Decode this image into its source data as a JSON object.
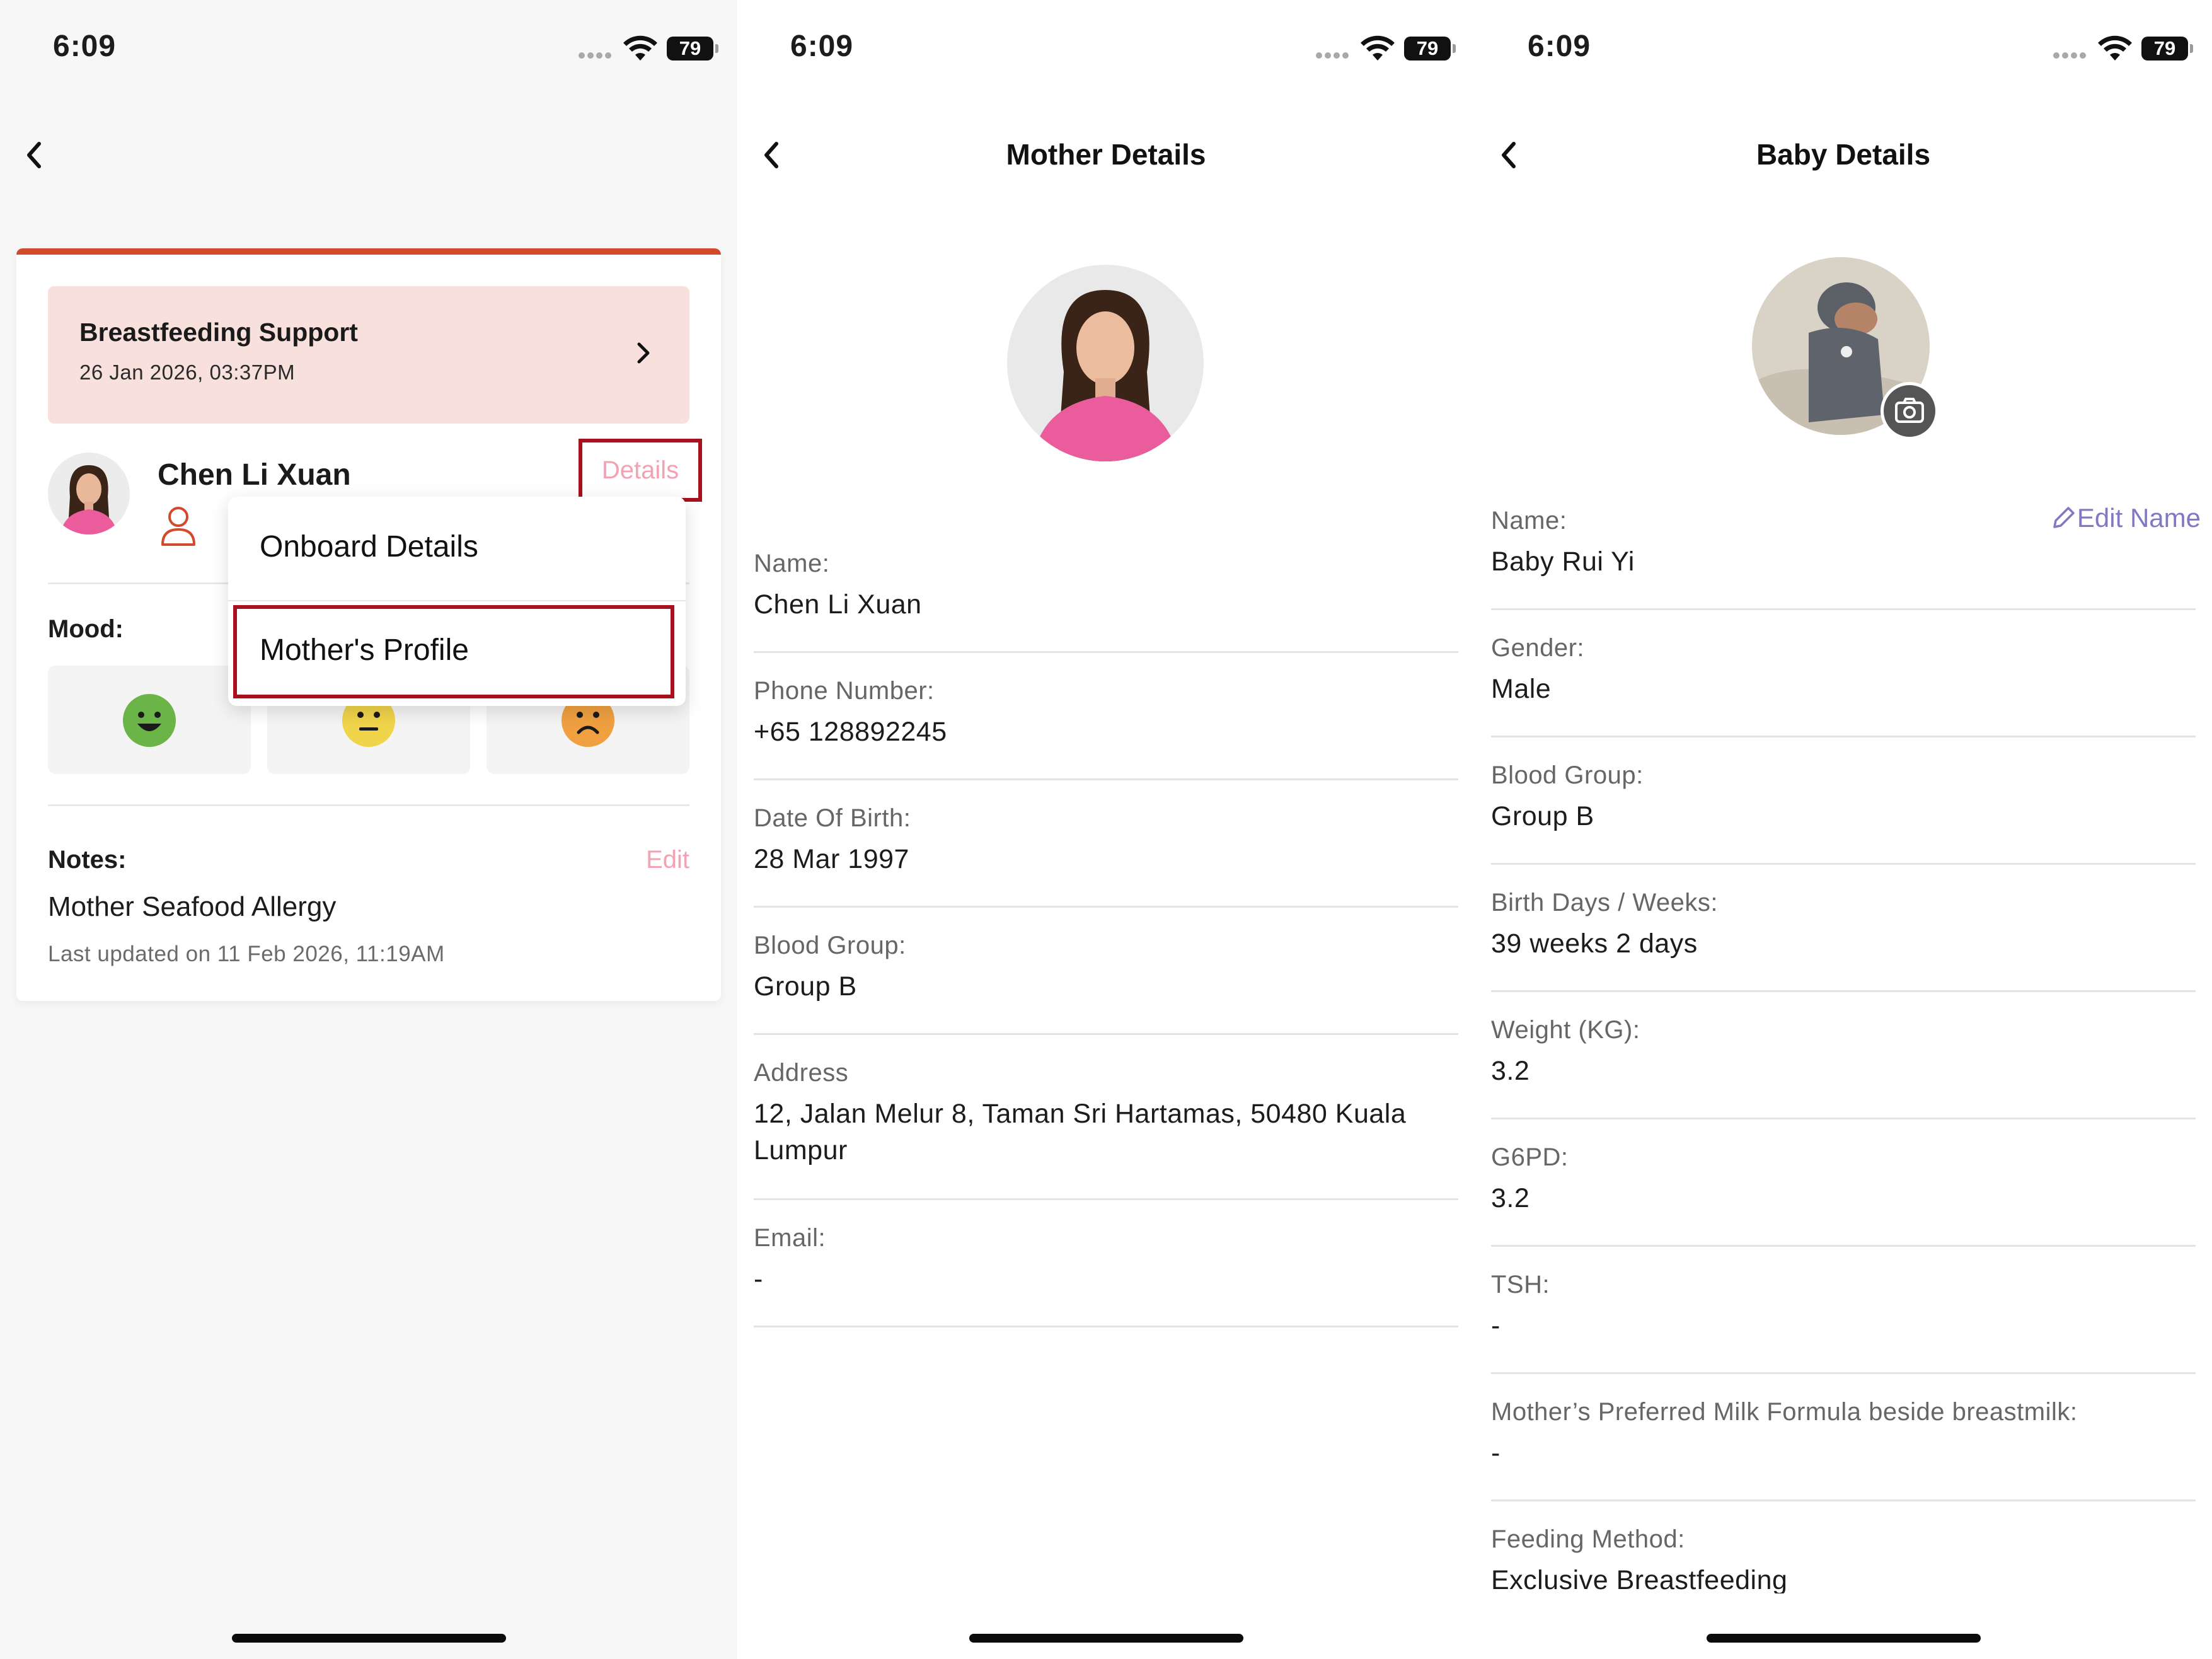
{
  "status_bar": {
    "time": "6:09",
    "battery": "79"
  },
  "screen1": {
    "session": {
      "title": "Breastfeeding Support",
      "date": "26 Jan 2026, 03:37PM"
    },
    "mother_name": "Chen Li Xuan",
    "details_link": "Details",
    "mood_label": "Mood:",
    "notes": {
      "label": "Notes:",
      "edit": "Edit",
      "text": "Mother Seafood Allergy",
      "updated": "Last updated on 11 Feb 2026, 11:19AM"
    },
    "dropdown": {
      "item1": "Onboard Details",
      "item2": "Mother's Profile"
    },
    "colors": {
      "accent": "#d24a2c",
      "highlight_box": "#a8111c",
      "session_bg": "#f8e1dc"
    }
  },
  "screen2": {
    "title": "Mother Details",
    "fields": [
      {
        "label": "Name:",
        "value": "Chen Li Xuan"
      },
      {
        "label": "Phone Number:",
        "value": "+65 128892245"
      },
      {
        "label": "Date Of Birth:",
        "value": "28 Mar 1997"
      },
      {
        "label": "Blood Group:",
        "value": "Group B"
      },
      {
        "label": "Address",
        "value_line1": "12, Jalan Melur 8, Taman Sri Hartamas, 50480 Kuala",
        "value_line2": "Lumpur"
      },
      {
        "label": "Email:",
        "value": "-"
      }
    ]
  },
  "screen3": {
    "title": "Baby Details",
    "edit_name": "Edit Name",
    "fields": [
      {
        "label": "Name:",
        "value": "Baby Rui Yi"
      },
      {
        "label": "Gender:",
        "value": "Male"
      },
      {
        "label": "Blood Group:",
        "value": "Group B"
      },
      {
        "label": "Birth Days / Weeks:",
        "value": "39 weeks 2 days"
      },
      {
        "label": "Weight (KG):",
        "value": "3.2"
      },
      {
        "label": "G6PD:",
        "value": "3.2"
      },
      {
        "label": "TSH:",
        "value": "-"
      },
      {
        "label": "Mother’s Preferred Milk Formula beside breastmilk:",
        "value": "-"
      },
      {
        "label": "Feeding Method:",
        "value": "Exclusive Breastfeeding"
      }
    ]
  }
}
